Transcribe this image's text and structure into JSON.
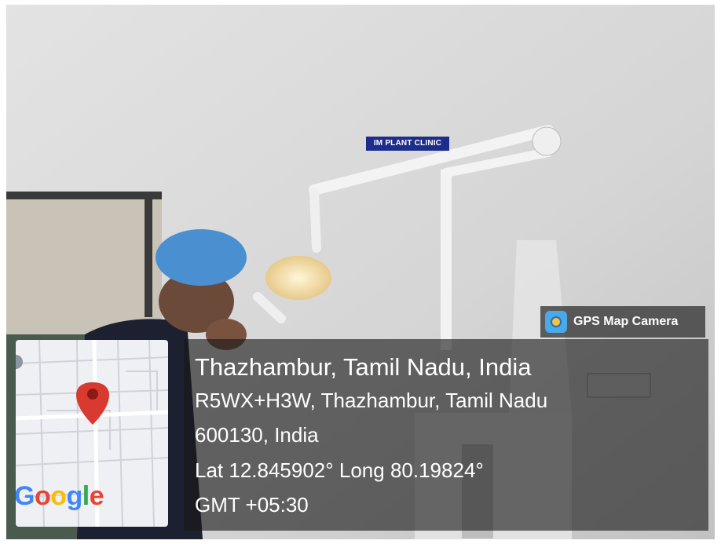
{
  "sign": {
    "text": "IM PLANT CLINIC"
  },
  "badge": {
    "label": "GPS Map Camera",
    "icon": "camera-lens-icon"
  },
  "location": {
    "line1": "Thazhambur, Tamil Nadu, India",
    "line2": "R5WX+H3W, Thazhambur, Tamil Nadu",
    "line3": "600130, India",
    "line4": "Lat 12.845902° Long 80.19824°",
    "line5": "GMT +05:30"
  },
  "map": {
    "pin_color": "#d93a2f",
    "logo_letters": [
      "G",
      "o",
      "o",
      "g",
      "l",
      "e"
    ],
    "logo_colors": [
      "#4285f4",
      "#ea4335",
      "#fbbc05",
      "#4285f4",
      "#34a853",
      "#ea4335"
    ]
  }
}
